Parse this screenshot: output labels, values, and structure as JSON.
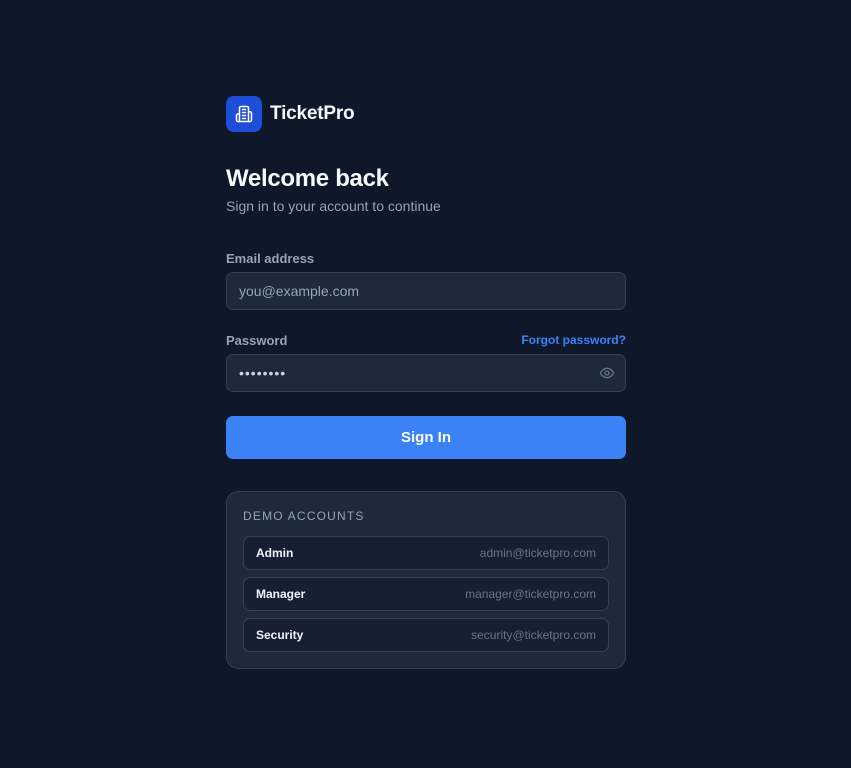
{
  "brand": {
    "name": "TicketPro",
    "logo_icon": "building-icon",
    "logo_color": "#1d4ed8"
  },
  "heading": {
    "title": "Welcome back",
    "subtitle": "Sign in to your account to continue"
  },
  "form": {
    "email": {
      "label": "Email address",
      "placeholder": "you@example.com",
      "value": ""
    },
    "password": {
      "label": "Password",
      "value_masked": "••••••••",
      "forgot_label": "Forgot password?",
      "toggle_icon": "eye-icon"
    },
    "submit_label": "Sign In"
  },
  "demo": {
    "title": "DEMO ACCOUNTS",
    "accounts": [
      {
        "role": "Admin",
        "email": "admin@ticketpro.com"
      },
      {
        "role": "Manager",
        "email": "manager@ticketpro.com"
      },
      {
        "role": "Security",
        "email": "security@ticketpro.com"
      }
    ]
  },
  "colors": {
    "background": "#0f172a",
    "surface": "#1e293b",
    "border": "#334155",
    "accent": "#3b82f6",
    "text_muted": "#94a3b8"
  }
}
